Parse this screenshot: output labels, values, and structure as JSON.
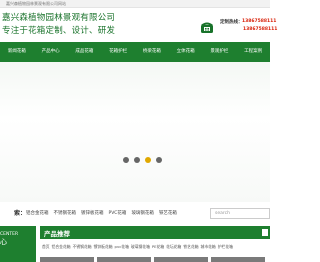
{
  "topbar": {
    "text": "嘉兴森植物园林景观有限公司网站"
  },
  "header": {
    "company_name": "嘉兴森植物园林景观有限公司",
    "slogan": "专注于花箱定制、设计、研发",
    "hotline_label": "定制热线：",
    "hotline_1": "13867588111",
    "hotline_2": "13867588111",
    "phone_icon": "phone-icon"
  },
  "nav": {
    "items": [
      "新闻花箱",
      "产品中心",
      "成品花箱",
      "花箱护栏",
      "桥梁花箱",
      "立体花箱",
      "景观护栏",
      "工程案例"
    ]
  },
  "banner": {
    "slide_count": 4,
    "active_slide": 3
  },
  "keywords": {
    "title": "索：",
    "items": [
      "铝合金花箱",
      "不锈钢花箱",
      "镀锌板花箱",
      "PVC花箱",
      "玻璃钢花箱",
      "铁艺花箱"
    ],
    "search_placeholder": "search"
  },
  "left_panel": {
    "en": "CENTER",
    "cn": "心"
  },
  "products": {
    "title": "产品推荐",
    "categories": [
      "首页",
      "铝合金花箱",
      "不锈钢花箱",
      "镀锌板花箱",
      "pvc花箱",
      "玻璃钢花箱",
      "PE花箱",
      "花坛花箱",
      "铁艺花箱",
      "城市花箱",
      "护栏花箱"
    ]
  }
}
